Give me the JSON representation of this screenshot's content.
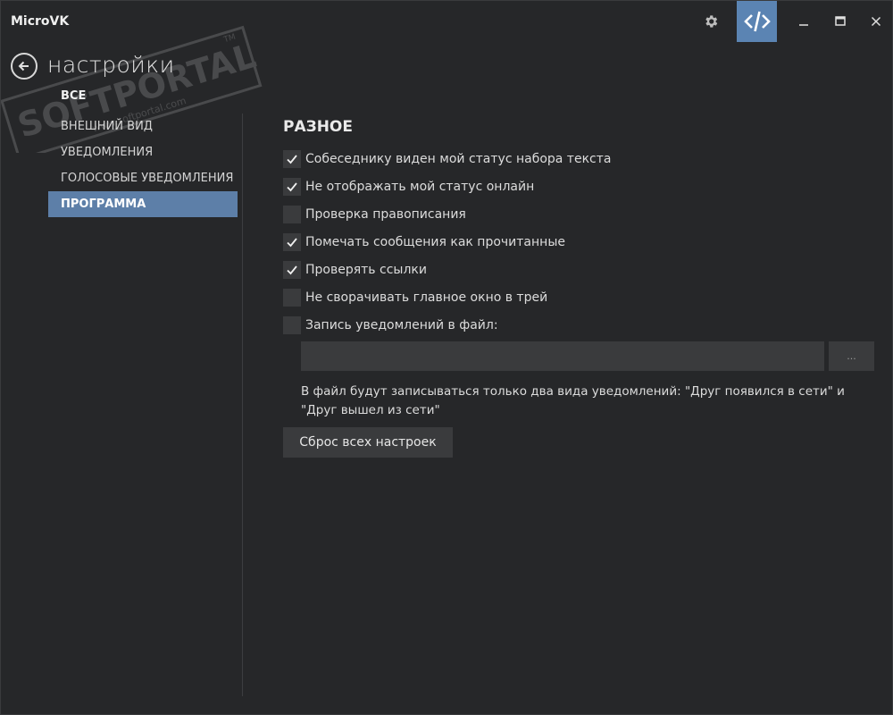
{
  "window": {
    "title": "MicroVK",
    "page_title": "настройки"
  },
  "titlebar": {
    "icons": [
      "gear-icon",
      "code-icon",
      "minimize-icon",
      "maximize-icon",
      "close-icon"
    ],
    "accent": "#5b84b3"
  },
  "watermark": {
    "brand": "SOFTPORTAL",
    "url": "www.softportal.com",
    "tm": "TM"
  },
  "nav": {
    "items": [
      {
        "label": "ВСЕ",
        "state": "bold"
      },
      {
        "label": "ВНЕШНИЙ ВИД",
        "state": "normal"
      },
      {
        "label": "УВЕДОМЛЕНИЯ",
        "state": "normal"
      },
      {
        "label": "ГОЛОСОВЫЕ УВЕДОМЛЕНИЯ",
        "state": "normal"
      },
      {
        "label": "ПРОГРАММА",
        "state": "active"
      }
    ],
    "active_color": "#5d7fa8"
  },
  "main": {
    "section_title": "РАЗНОЕ",
    "options": [
      {
        "label": "Собеседнику виден мой статус набора текста",
        "checked": true
      },
      {
        "label": "Не отображать мой статус онлайн",
        "checked": true
      },
      {
        "label": "Проверка правописания",
        "checked": false
      },
      {
        "label": "Помечать сообщения как прочитанные",
        "checked": true
      },
      {
        "label": "Проверять ссылки",
        "checked": true
      },
      {
        "label": "Не сворачивать главное окно в трей",
        "checked": false
      },
      {
        "label": "Запись уведомлений в файл:",
        "checked": false
      }
    ],
    "file_path": {
      "value": "",
      "placeholder": ""
    },
    "browse_label": "...",
    "hint": "В файл будут записываться только два вида уведомлений: \"Друг появился в сети\" и \"Друг вышел из сети\"",
    "reset_label": "Сброс всех настроек"
  }
}
